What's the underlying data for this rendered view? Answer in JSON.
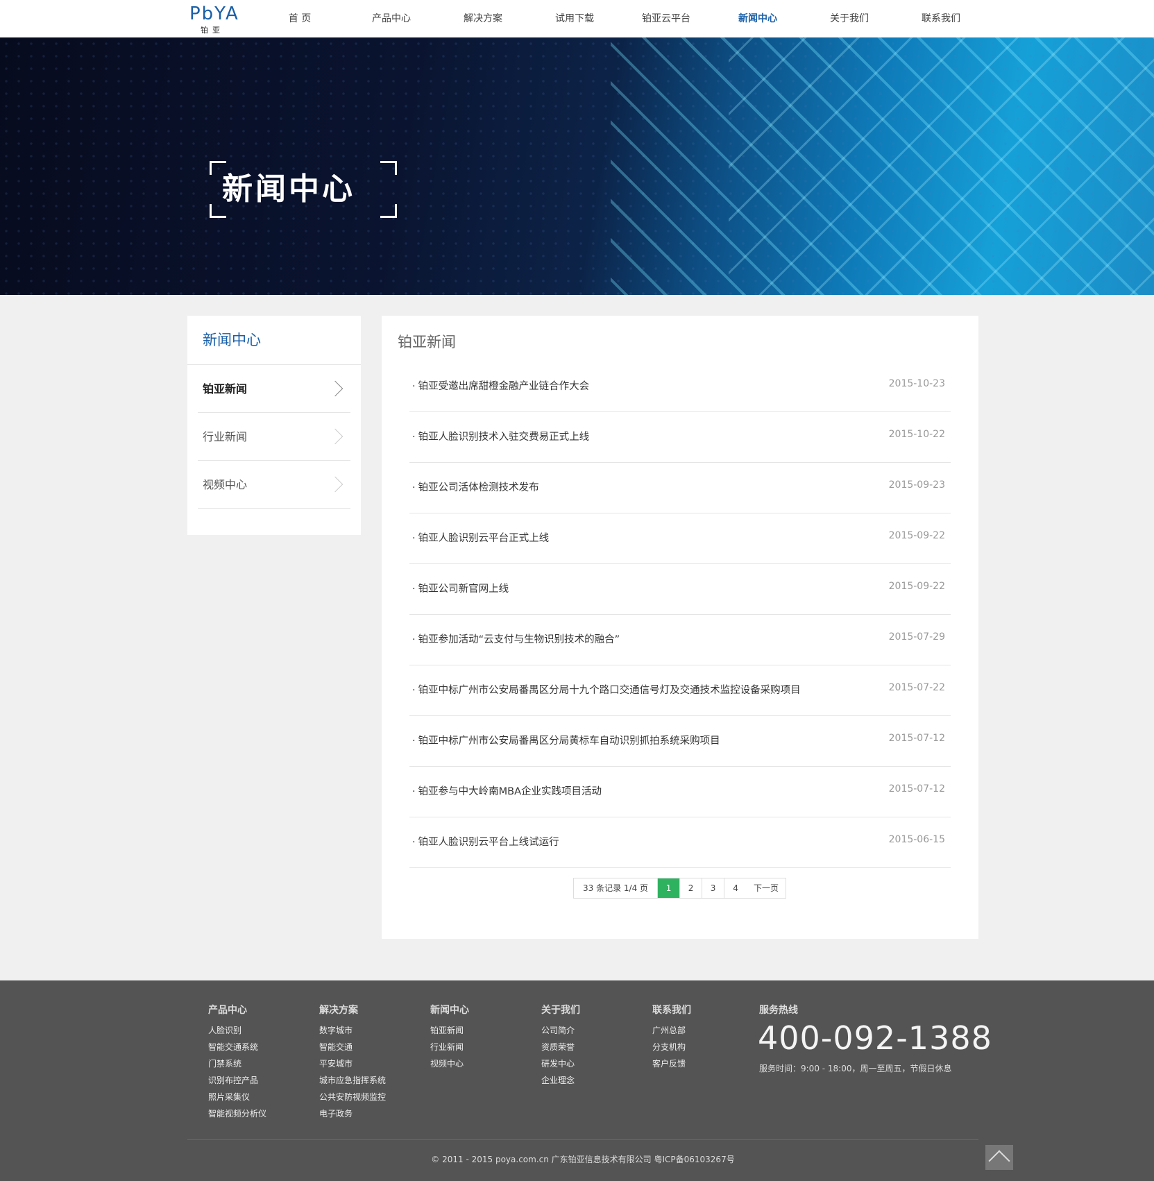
{
  "brand": {
    "logo_mark": "PbYA",
    "logo_sub": "铂亚"
  },
  "nav": {
    "items": [
      "首 页",
      "产品中心",
      "解决方案",
      "试用下载",
      "铂亚云平台",
      "新闻中心",
      "关于我们",
      "联系我们"
    ],
    "active": "新闻中心"
  },
  "banner": {
    "title": "新闻中心"
  },
  "sidebar": {
    "title": "新闻中心",
    "items": [
      {
        "label": "铂亚新闻",
        "active": true
      },
      {
        "label": "行业新闻",
        "active": false
      },
      {
        "label": "视频中心",
        "active": false
      }
    ]
  },
  "main": {
    "title": "铂亚新闻",
    "news": [
      {
        "title": "铂亚受邀出席甜橙金融产业链合作大会",
        "date": "2015-10-23"
      },
      {
        "title": "铂亚人脸识别技术入驻交费易正式上线",
        "date": "2015-10-22"
      },
      {
        "title": "铂亚公司活体检测技术发布",
        "date": "2015-09-23"
      },
      {
        "title": "铂亚人脸识别云平台正式上线",
        "date": "2015-09-22"
      },
      {
        "title": "铂亚公司新官网上线",
        "date": "2015-09-22"
      },
      {
        "title": "铂亚参加活动“云支付与生物识别技术的融合”",
        "date": "2015-07-29"
      },
      {
        "title": "铂亚中标广州市公安局番禺区分局十九个路口交通信号灯及交通技术监控设备采购项目",
        "date": "2015-07-22"
      },
      {
        "title": "铂亚中标广州市公安局番禺区分局黄标车自动识别抓拍系统采购项目",
        "date": "2015-07-12"
      },
      {
        "title": "铂亚参与中大岭南MBA企业实践项目活动",
        "date": "2015-07-12"
      },
      {
        "title": "铂亚人脸识别云平台上线试运行",
        "date": "2015-06-15"
      }
    ],
    "pager": {
      "info": "33 条记录 1/4 页",
      "pages": [
        "1",
        "2",
        "3",
        "4"
      ],
      "current": "1",
      "next": "下一页"
    }
  },
  "footer": {
    "columns": [
      {
        "head": "产品中心",
        "links": [
          "人脸识别",
          "智能交通系统",
          "门禁系统",
          "识别布控产品",
          "照片采集仪",
          "智能视频分析仪"
        ]
      },
      {
        "head": "解决方案",
        "links": [
          "数字城市",
          "智能交通",
          "平安城市",
          "城市应急指挥系统",
          "公共安防视频监控",
          "电子政务"
        ]
      },
      {
        "head": "新闻中心",
        "links": [
          "铂亚新闻",
          "行业新闻",
          "视频中心"
        ]
      },
      {
        "head": "关于我们",
        "links": [
          "公司简介",
          "资质荣誉",
          "研发中心",
          "企业理念"
        ]
      },
      {
        "head": "联系我们",
        "links": [
          "广州总部",
          "分支机构",
          "客户反馈"
        ]
      }
    ],
    "hotline_head": "服务热线",
    "hotline": "400-092-1388",
    "hours": "服务时间：9:00 - 18:00，周一至周五，节假日休息",
    "copyright": "© 2011 - 2015 poya.com.cn 广东铂亚信息技术有限公司 粤ICP备06103267号"
  },
  "colors": {
    "brand_blue": "#1a5fa8",
    "pager_active": "#2eb260",
    "footer_bg": "#545454"
  }
}
